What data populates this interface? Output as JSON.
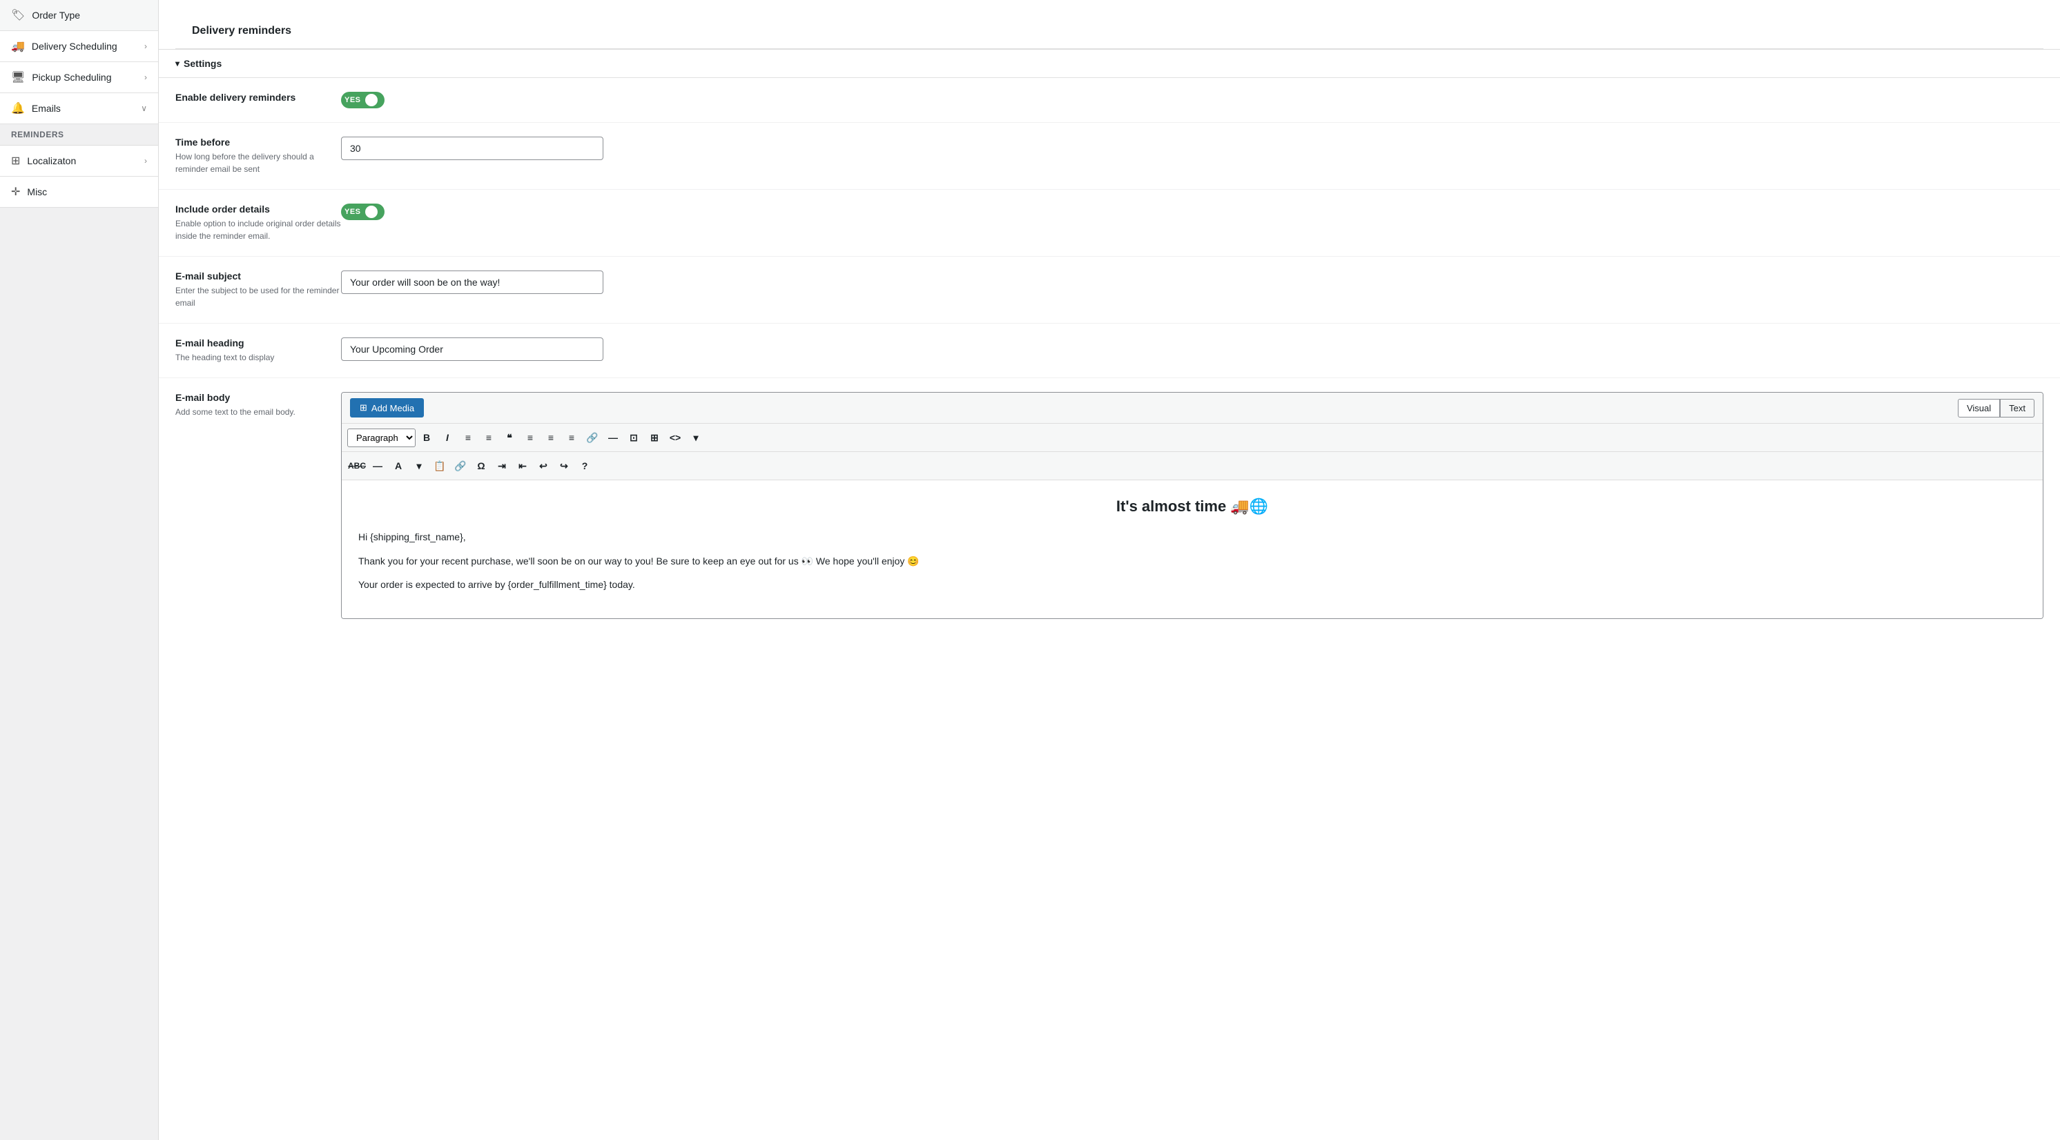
{
  "sidebar": {
    "items": [
      {
        "id": "order-type",
        "label": "Order Type",
        "icon": "🏷",
        "hasChevron": false
      },
      {
        "id": "delivery-scheduling",
        "label": "Delivery Scheduling",
        "icon": "🚚",
        "hasChevron": true,
        "active": true
      },
      {
        "id": "pickup-scheduling",
        "label": "Pickup Scheduling",
        "icon": "🖥",
        "hasChevron": true
      },
      {
        "id": "emails",
        "label": "Emails",
        "icon": "🔔",
        "hasChevron": true,
        "expanded": true
      }
    ],
    "section_label": "Reminders",
    "bottom_items": [
      {
        "id": "localization",
        "label": "Localizaton",
        "icon": "⊞",
        "hasChevron": true
      },
      {
        "id": "misc",
        "label": "Misc",
        "icon": "✛",
        "hasChevron": false
      }
    ]
  },
  "page": {
    "section_title": "Delivery reminders",
    "settings_section_label": "Settings",
    "settings_chevron": "▾"
  },
  "enable_reminders": {
    "label": "Enable delivery reminders",
    "toggle_label": "YES",
    "value": true
  },
  "time_before": {
    "label": "Time before",
    "description": "How long before the delivery should a reminder email be sent",
    "value": "30"
  },
  "include_order_details": {
    "label": "Include order details",
    "description": "Enable option to include original order details inside the reminder email.",
    "toggle_label": "YES",
    "value": true
  },
  "email_subject": {
    "label": "E-mail subject",
    "description": "Enter the subject to be used for the reminder email",
    "value": "Your order will soon be on the way!"
  },
  "email_heading": {
    "label": "E-mail heading",
    "description": "The heading text to display",
    "value": "Your Upcoming Order"
  },
  "email_body": {
    "label": "E-mail body",
    "description": "Add some text to the email body.",
    "add_media_label": "Add Media",
    "tab_visual": "Visual",
    "tab_text": "Text",
    "editor_heading": "It's almost time 🚚🌐",
    "para1": "Hi {shipping_first_name},",
    "para2": "Thank you for your recent purchase, we'll soon be on our way to you! Be sure to keep an eye out for us 👀 We hope you'll enjoy 😊",
    "para3": "Your order is expected to arrive by {order_fulfillment_time} today."
  },
  "toolbar": {
    "paragraph_select": "Paragraph",
    "buttons": [
      "B",
      "I",
      "≡",
      "≡",
      "❝",
      "≡",
      "≡",
      "≡",
      "🔗",
      "—",
      "⊡",
      "⊞",
      "<>"
    ]
  }
}
